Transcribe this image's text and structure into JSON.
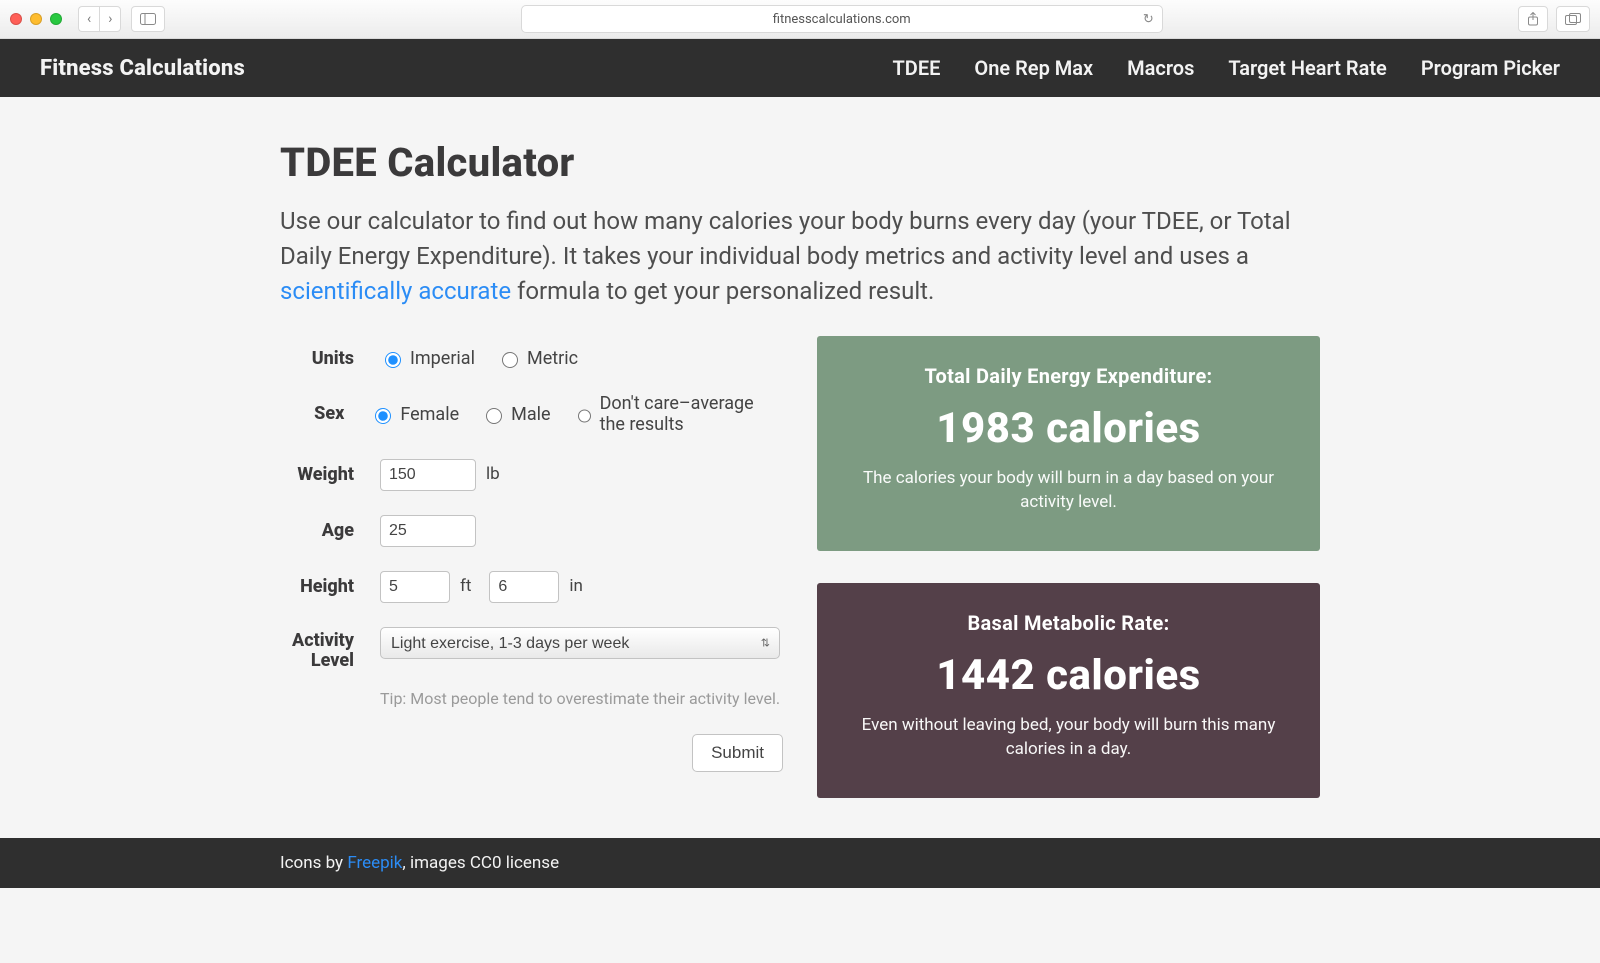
{
  "browser": {
    "url_display": "fitnesscalculations.com"
  },
  "nav": {
    "brand": "Fitness Calculations",
    "links": [
      "TDEE",
      "One Rep Max",
      "Macros",
      "Target Heart Rate",
      "Program Picker"
    ]
  },
  "page": {
    "title": "TDEE Calculator",
    "lead_pre": "Use our calculator to find out how many calories your body burns every day (your TDEE, or Total Daily Energy Expenditure). It takes your individual body metrics and activity level and uses a ",
    "lead_link": "scientifically accurate",
    "lead_post": " formula to get your personalized result."
  },
  "form": {
    "labels": {
      "units": "Units",
      "sex": "Sex",
      "weight": "Weight",
      "age": "Age",
      "height": "Height",
      "activity": "Activity Level"
    },
    "units": {
      "options": [
        "Imperial",
        "Metric"
      ],
      "selected": "Imperial"
    },
    "sex": {
      "options": [
        "Female",
        "Male",
        "Don't care–average the results"
      ],
      "selected": "Female"
    },
    "weight": {
      "value": "150",
      "unit": "lb"
    },
    "age": {
      "value": "25"
    },
    "height": {
      "feet_value": "5",
      "feet_unit": "ft",
      "inches_value": "6",
      "inches_unit": "in"
    },
    "activity": {
      "selected": "Light exercise, 1-3 days per week",
      "tip": "Tip: Most people tend to overestimate their activity level."
    },
    "submit": "Submit"
  },
  "results": {
    "tdee": {
      "head": "Total Daily Energy Expenditure:",
      "big": "1983 calories",
      "desc": "The calories your body will burn in a day based on your activity level."
    },
    "bmr": {
      "head": "Basal Metabolic Rate:",
      "big": "1442 calories",
      "desc": "Even without leaving bed, your body will burn this many calories in a day."
    }
  },
  "footer": {
    "pre": "Icons by ",
    "link": "Freepik",
    "post": ", images CC0 license"
  }
}
